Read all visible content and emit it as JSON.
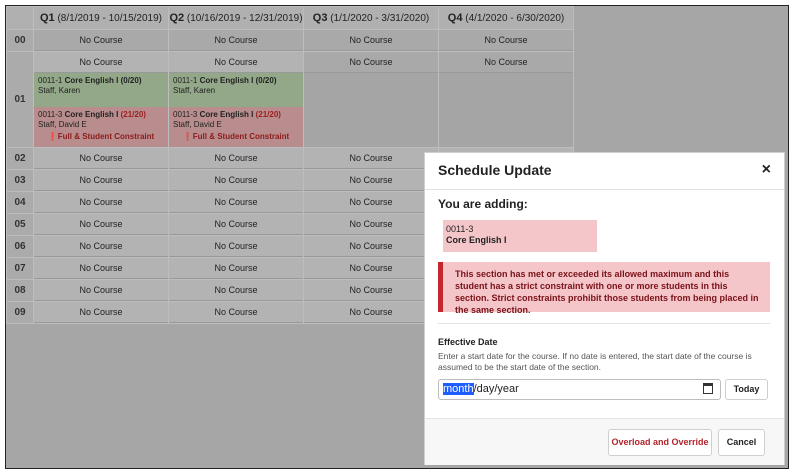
{
  "quarters": [
    {
      "name": "Q1",
      "range": "(8/1/2019 - 10/15/2019)"
    },
    {
      "name": "Q2",
      "range": "(10/16/2019 - 12/31/2019)"
    },
    {
      "name": "Q3",
      "range": "(1/1/2020 - 3/31/2020)"
    },
    {
      "name": "Q4",
      "range": "(4/1/2020 - 6/30/2020)"
    }
  ],
  "periods": [
    "00",
    "01",
    "02",
    "03",
    "04",
    "05",
    "06",
    "07",
    "08",
    "09"
  ],
  "no_course": "No Course",
  "sections": {
    "green": {
      "code": "0011-1",
      "course": "Core English I",
      "count": "(0/20)",
      "staff": "Staff, Karen"
    },
    "red": {
      "code": "0011-3",
      "course": "Core English I",
      "count": "(21/20)",
      "staff": "Staff, David E",
      "warning": "Full & Student Constraint"
    }
  },
  "modal": {
    "title": "Schedule Update",
    "close": "×",
    "adding_label": "You are adding:",
    "chip_code": "0011-3",
    "chip_course": "Core English I",
    "alert": "This section has met or exceeded its allowed maximum and this student has a strict constraint with one or more students in this section. Strict constraints prohibit those students from being placed in the same section.",
    "effective_label": "Effective Date",
    "effective_help": "Enter a start date for the course. If no date is entered, the start date of the course is assumed to be the start date of the section.",
    "date_month": "month",
    "date_rest": "/day/year",
    "today": "Today",
    "overload": "Overload and Override",
    "cancel": "Cancel"
  },
  "colors": {
    "alert_border": "#c4262e",
    "chip_bg": "#f4c6ca",
    "overload_text": "#b3232b"
  }
}
